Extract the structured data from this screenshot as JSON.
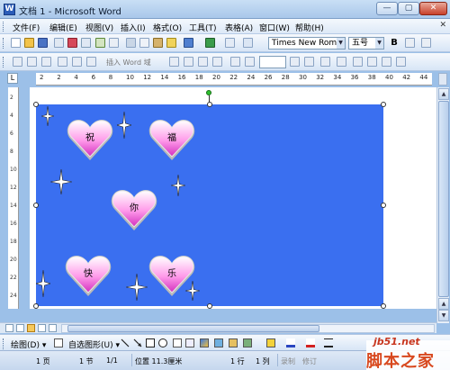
{
  "window": {
    "title": "文档 1 - Microsoft Word",
    "app_icon_letter": "W",
    "minimize": "—",
    "maximize": "▢",
    "close": "✕"
  },
  "menubar": {
    "items": [
      "文件(F)",
      "编辑(E)",
      "视图(V)",
      "插入(I)",
      "格式(O)",
      "工具(T)",
      "表格(A)",
      "窗口(W)",
      "帮助(H)"
    ],
    "close_glyph": "✕"
  },
  "toolbar1": {
    "font_name": "Times New Roman",
    "font_size": "五号",
    "bold": "B"
  },
  "toolbar2": {
    "mail_merge": "插入 Word 域"
  },
  "ruler": {
    "corner": "L",
    "h_numbers": [
      "2",
      "2",
      "4",
      "6",
      "8",
      "10",
      "12",
      "14",
      "16",
      "18",
      "20",
      "22",
      "24",
      "26",
      "28",
      "30",
      "32",
      "34",
      "36",
      "38",
      "40",
      "42",
      "44"
    ],
    "v_numbers": [
      "2",
      "4",
      "6",
      "8",
      "10",
      "12",
      "14",
      "16",
      "18",
      "20",
      "22",
      "24"
    ]
  },
  "canvas": {
    "background_color": "#3a6ff0",
    "hearts": [
      {
        "text": "祝"
      },
      {
        "text": "福"
      },
      {
        "text": "你"
      },
      {
        "text": "快"
      },
      {
        "text": "乐"
      }
    ],
    "heart_colors": {
      "top": "#ffffff",
      "middle": "#ff8ce6",
      "bottom": "#d42fc2",
      "outline": "#b8b8b8"
    }
  },
  "drawbar": {
    "draw": "绘图(D) ▾",
    "autoshapes": "自选图形(U) ▾"
  },
  "statusbar": {
    "page": "1 页",
    "section": "1 节",
    "page_of": "1/1",
    "position": "位置 11.3厘米",
    "line": "1 行",
    "column": "1 列",
    "rec": "录制",
    "trk": "修订"
  },
  "watermark": {
    "line1": "jb51.net",
    "line2": "脚本之家"
  }
}
